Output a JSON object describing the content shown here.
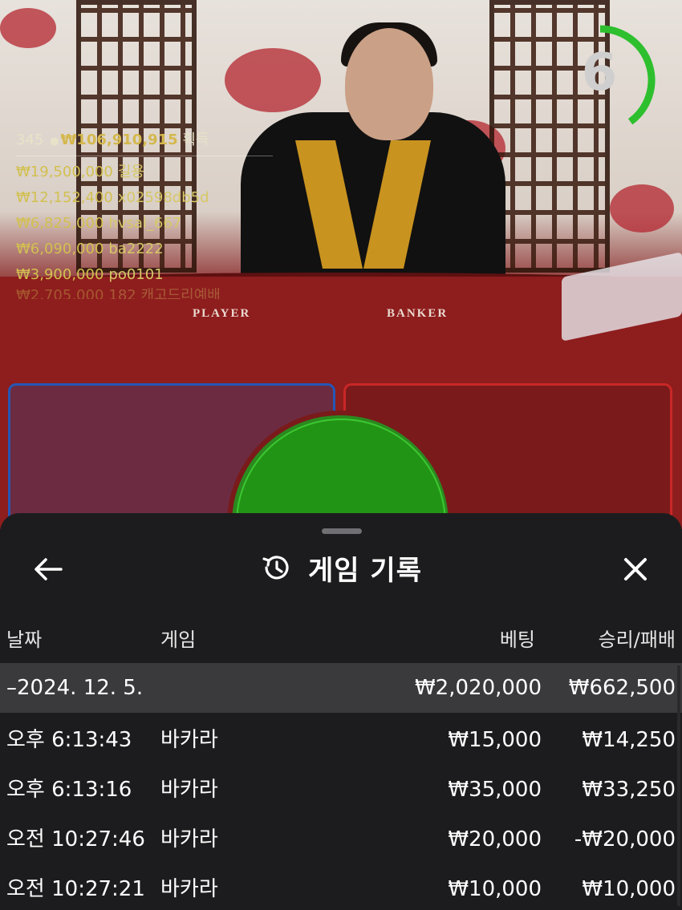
{
  "timer": {
    "value": "6",
    "progress": 0.4,
    "color": "#2ebf2e"
  },
  "scene": {
    "player_label": "PLAYER",
    "banker_label": "BANKER"
  },
  "winners": {
    "count": "345",
    "total": "₩106,910,915",
    "suffix": "획득",
    "rows": [
      {
        "amount": "₩19,500,000",
        "name": "길용"
      },
      {
        "amount": "₩12,152,400",
        "name": "x02598db5d"
      },
      {
        "amount": "₩6,825,000",
        "name": "hvsal_667"
      },
      {
        "amount": "₩6,090,000",
        "name": "ba2222"
      },
      {
        "amount": "₩3,900,000",
        "name": "po0101"
      },
      {
        "amount": "₩2,705,000",
        "name": "182 캐고드리예배"
      }
    ]
  },
  "sheet": {
    "title": "게임 기록",
    "back_icon": "arrow-left-icon",
    "history_icon": "history-clock-icon",
    "close_icon": "close-icon",
    "columns": {
      "date": "날짜",
      "game": "게임",
      "bet": "베팅",
      "result": "승리/패배"
    },
    "group": {
      "date": "–2024. 12. 5.",
      "bet": "₩2,020,000",
      "result": "₩662,500"
    },
    "rows": [
      {
        "time": "오후 6:13:43",
        "game": "바카라",
        "bet": "₩15,000",
        "result": "₩14,250"
      },
      {
        "time": "오후 6:13:16",
        "game": "바카라",
        "bet": "₩35,000",
        "result": "₩33,250"
      },
      {
        "time": "오전 10:27:46",
        "game": "바카라",
        "bet": "₩20,000",
        "result": "-₩20,000"
      },
      {
        "time": "오전 10:27:21",
        "game": "바카라",
        "bet": "₩10,000",
        "result": "₩10,000"
      }
    ]
  }
}
